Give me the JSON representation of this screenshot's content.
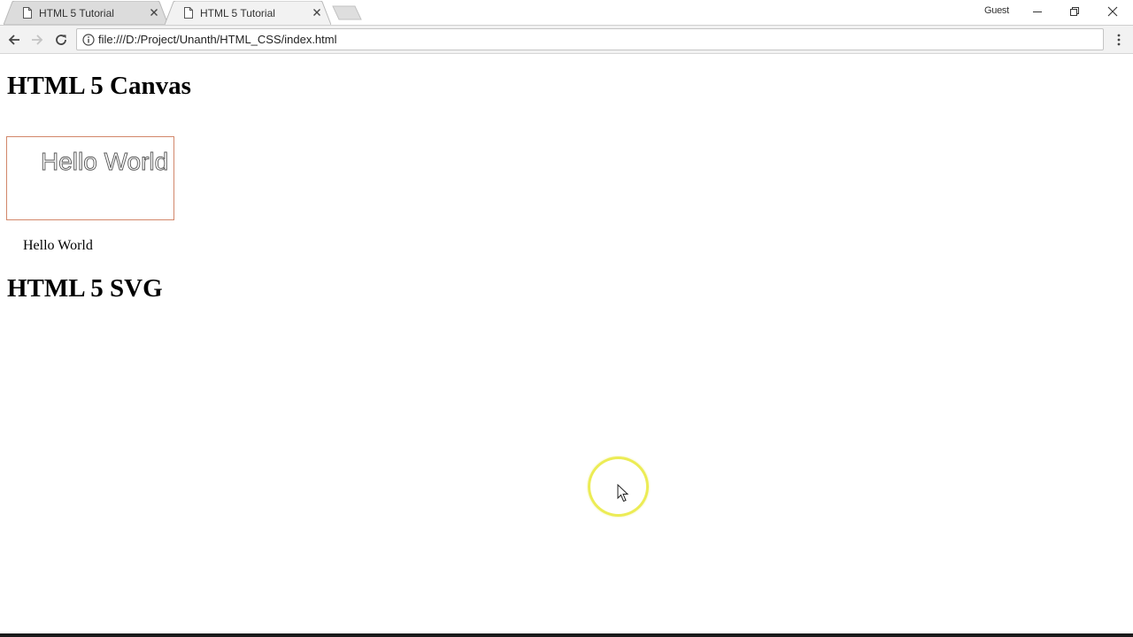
{
  "browser": {
    "tabs": [
      {
        "title": "HTML 5 Tutorial",
        "active": false,
        "icon": "document-icon"
      },
      {
        "title": "HTML 5 Tutorial",
        "active": true,
        "icon": "document-icon"
      }
    ],
    "profile_label": "Guest",
    "address_bar": {
      "url": "file:///D:/Project/Unanth/HTML_CSS/index.html",
      "security_icon": "info-icon"
    },
    "window_controls": [
      "minimize-icon",
      "restore-icon",
      "close-icon"
    ]
  },
  "page": {
    "canvas_heading": "HTML 5 Canvas",
    "canvas_text": "Hello World",
    "canvas_border_color": "#d2876a",
    "fallback_text": "Hello World",
    "svg_heading": "HTML 5 SVG"
  },
  "colors": {
    "toolbar_bg": "#f2f2f2",
    "inactive_tab_bg": "#dcdcdc",
    "cursor_highlight": "#ecec55"
  }
}
